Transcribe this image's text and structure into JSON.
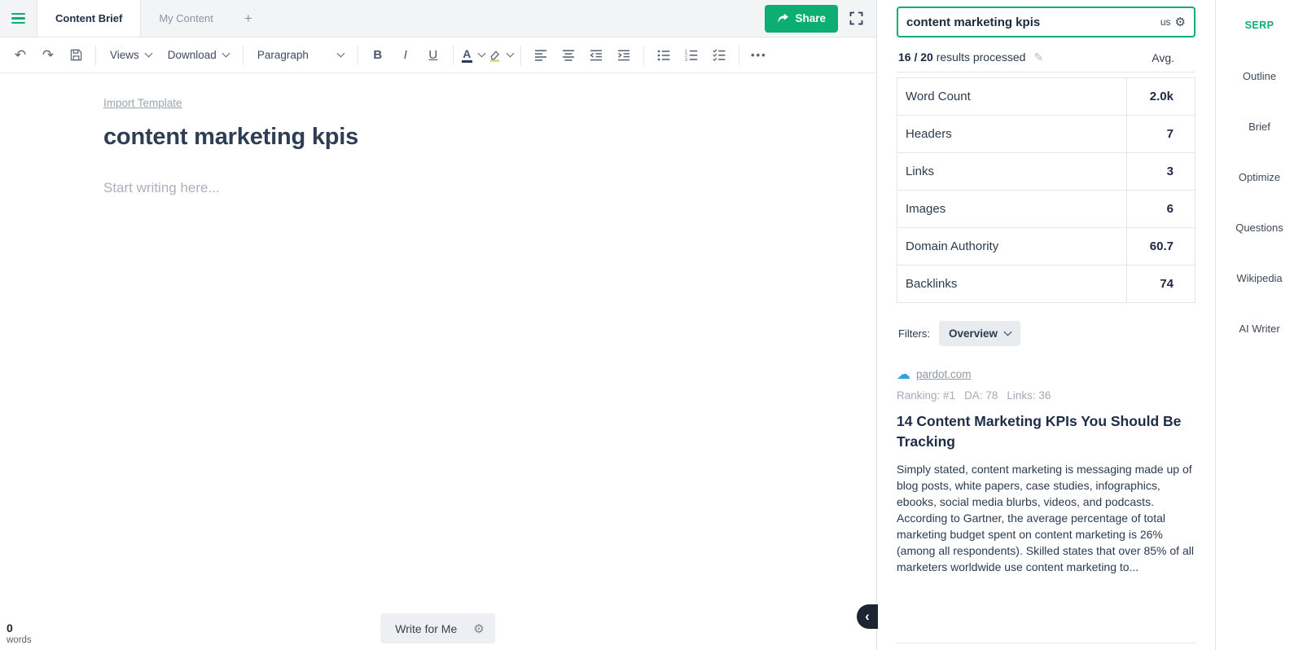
{
  "colors": {
    "accent_green": "#0cae74",
    "dark_navy": "#1e2a3c",
    "link_gray": "#8f99a3"
  },
  "tab_bar": {
    "tabs": [
      {
        "label": "Content Brief",
        "active": true
      },
      {
        "label": "My Content",
        "active": false
      }
    ],
    "add_tab": "+",
    "share_label": "Share"
  },
  "toolbar": {
    "views": "Views",
    "download": "Download",
    "paragraph": "Paragraph",
    "bold": "B",
    "italic": "I",
    "underline": "U",
    "text_color": "A",
    "more": "•••"
  },
  "icons": {
    "undo": "↶",
    "redo": "↷",
    "gear": "⚙",
    "pencil": "✎",
    "cloud": "☁",
    "collapse": "‹"
  },
  "document": {
    "import_template": "Import Template",
    "title": "content marketing kpis",
    "placeholder": "Start writing here..."
  },
  "footer": {
    "word_count": "0",
    "words_label": "words",
    "write_for_me": "Write for Me"
  },
  "serp": {
    "query": "content marketing kpis",
    "country": "us",
    "progress_count": "16 / 20",
    "progress_text": "results processed",
    "avg_label": "Avg.",
    "stats": [
      {
        "label": "Word Count",
        "value": "2.0k"
      },
      {
        "label": "Headers",
        "value": "7"
      },
      {
        "label": "Links",
        "value": "3"
      },
      {
        "label": "Images",
        "value": "6"
      },
      {
        "label": "Domain Authority",
        "value": "60.7"
      },
      {
        "label": "Backlinks",
        "value": "74"
      }
    ],
    "filters_label": "Filters:",
    "filter_value": "Overview",
    "result": {
      "domain": "pardot.com",
      "ranking": "Ranking: #1",
      "da": "DA: 78",
      "links": "Links: 36",
      "title": "14 Content Marketing KPIs You Should Be Tracking",
      "snippet": "Simply stated, content marketing is messaging made up of blog posts, white papers, case studies, infographics, ebooks, social media blurbs, videos, and podcasts.   According to Gartner, the average percentage of total marketing budget spent on content marketing is 26% (among all respondents). Skilled states that over 85% of all marketers worldwide use content marketing to..."
    }
  },
  "nav": {
    "items": [
      {
        "label": "SERP",
        "active": true
      },
      {
        "label": "Outline",
        "active": false
      },
      {
        "label": "Brief",
        "active": false
      },
      {
        "label": "Optimize",
        "active": false
      },
      {
        "label": "Questions",
        "active": false
      },
      {
        "label": "Wikipedia",
        "active": false
      },
      {
        "label": "AI Writer",
        "active": false
      }
    ]
  }
}
